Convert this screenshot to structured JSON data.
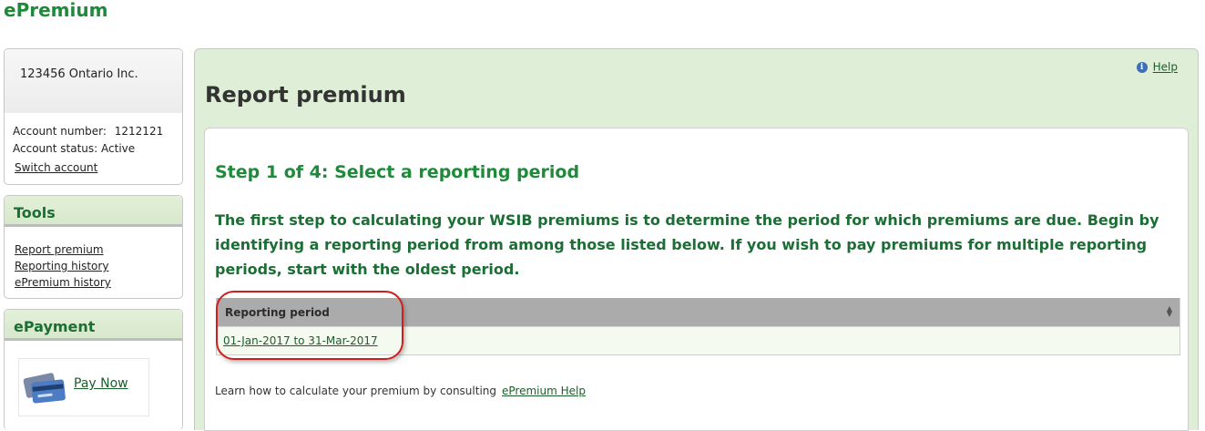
{
  "brand": "ePremium",
  "account": {
    "company": "123456 Ontario Inc.",
    "number_label": "Account number:",
    "number_value": "1212121",
    "status_label": "Account status:",
    "status_value": "Active",
    "switch_label": "Switch account"
  },
  "tools": {
    "title": "Tools",
    "links": [
      "Report premium",
      "Reporting history",
      "ePremium history"
    ]
  },
  "epayment": {
    "title": "ePayment",
    "pay_label": "Pay Now",
    "icon": "credit-card-icon"
  },
  "main": {
    "help_label": "Help",
    "help_icon": "info-icon",
    "page_title": "Report premium",
    "step_title": "Step 1 of 4: Select a reporting period",
    "intro_text": "The first step to calculating your WSIB premiums is to determine the period for which premiums are due. Begin by identifying a reporting period from among those listed below. If you wish to pay premiums for multiple reporting periods, start with the oldest period.",
    "table": {
      "header": "Reporting period",
      "rows": [
        "01-Jan-2017 to 31-Mar-2017"
      ]
    },
    "footer_text": "Learn how to calculate your premium by consulting",
    "footer_link": "ePremium Help"
  },
  "colors": {
    "brand_green": "#1e8a3a",
    "panel_green": "#dfeed6",
    "annotation_red": "#cc1f1f"
  }
}
